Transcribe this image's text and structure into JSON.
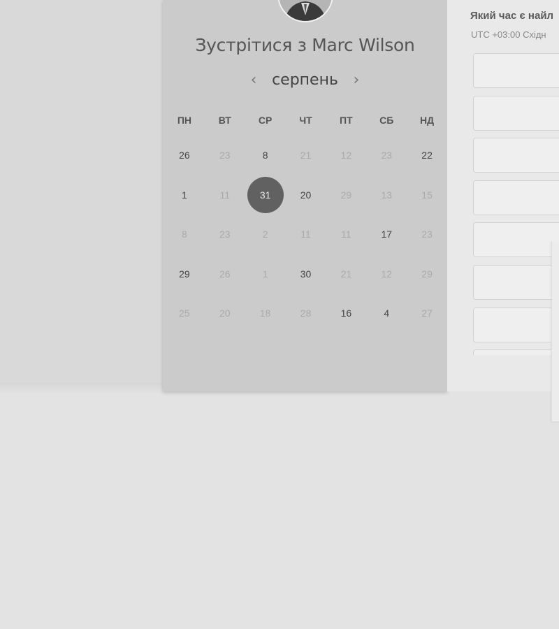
{
  "header": {
    "title": "Зустрітися з Marc Wilson"
  },
  "calendar": {
    "month": "серпень",
    "prev_icon": "chevron-left-icon",
    "next_icon": "chevron-right-icon",
    "weekdays": [
      "ПН",
      "ВТ",
      "СР",
      "ЧТ",
      "ПТ",
      "СБ",
      "НД"
    ],
    "weeks": [
      [
        {
          "d": "26",
          "s": "active"
        },
        {
          "d": "23",
          "s": "inactive"
        },
        {
          "d": "8",
          "s": "active"
        },
        {
          "d": "21",
          "s": "inactive"
        },
        {
          "d": "12",
          "s": "inactive"
        },
        {
          "d": "23",
          "s": "inactive"
        },
        {
          "d": "22",
          "s": "active"
        }
      ],
      [
        {
          "d": "1",
          "s": "active"
        },
        {
          "d": "11",
          "s": "inactive"
        },
        {
          "d": "31",
          "s": "selected"
        },
        {
          "d": "20",
          "s": "active"
        },
        {
          "d": "29",
          "s": "inactive"
        },
        {
          "d": "13",
          "s": "inactive"
        },
        {
          "d": "15",
          "s": "inactive"
        }
      ],
      [
        {
          "d": "8",
          "s": "inactive"
        },
        {
          "d": "23",
          "s": "inactive"
        },
        {
          "d": "2",
          "s": "inactive"
        },
        {
          "d": "11",
          "s": "inactive"
        },
        {
          "d": "11",
          "s": "inactive"
        },
        {
          "d": "17",
          "s": "active"
        },
        {
          "d": "23",
          "s": "inactive"
        }
      ],
      [
        {
          "d": "29",
          "s": "active"
        },
        {
          "d": "26",
          "s": "inactive"
        },
        {
          "d": "1",
          "s": "inactive"
        },
        {
          "d": "30",
          "s": "active"
        },
        {
          "d": "21",
          "s": "inactive"
        },
        {
          "d": "12",
          "s": "inactive"
        },
        {
          "d": "29",
          "s": "inactive"
        }
      ],
      [
        {
          "d": "25",
          "s": "inactive"
        },
        {
          "d": "20",
          "s": "inactive"
        },
        {
          "d": "18",
          "s": "inactive"
        },
        {
          "d": "28",
          "s": "inactive"
        },
        {
          "d": "16",
          "s": "active"
        },
        {
          "d": "4",
          "s": "active"
        },
        {
          "d": "27",
          "s": "inactive"
        }
      ]
    ]
  },
  "times": {
    "title": "Який час є найл",
    "timezone": "UTC +03:00 Східн",
    "slot_count": 7
  },
  "colors": {
    "selected_day": "#616161",
    "card_background": "#cbcbcb",
    "panel_background": "#e9e9e9"
  }
}
